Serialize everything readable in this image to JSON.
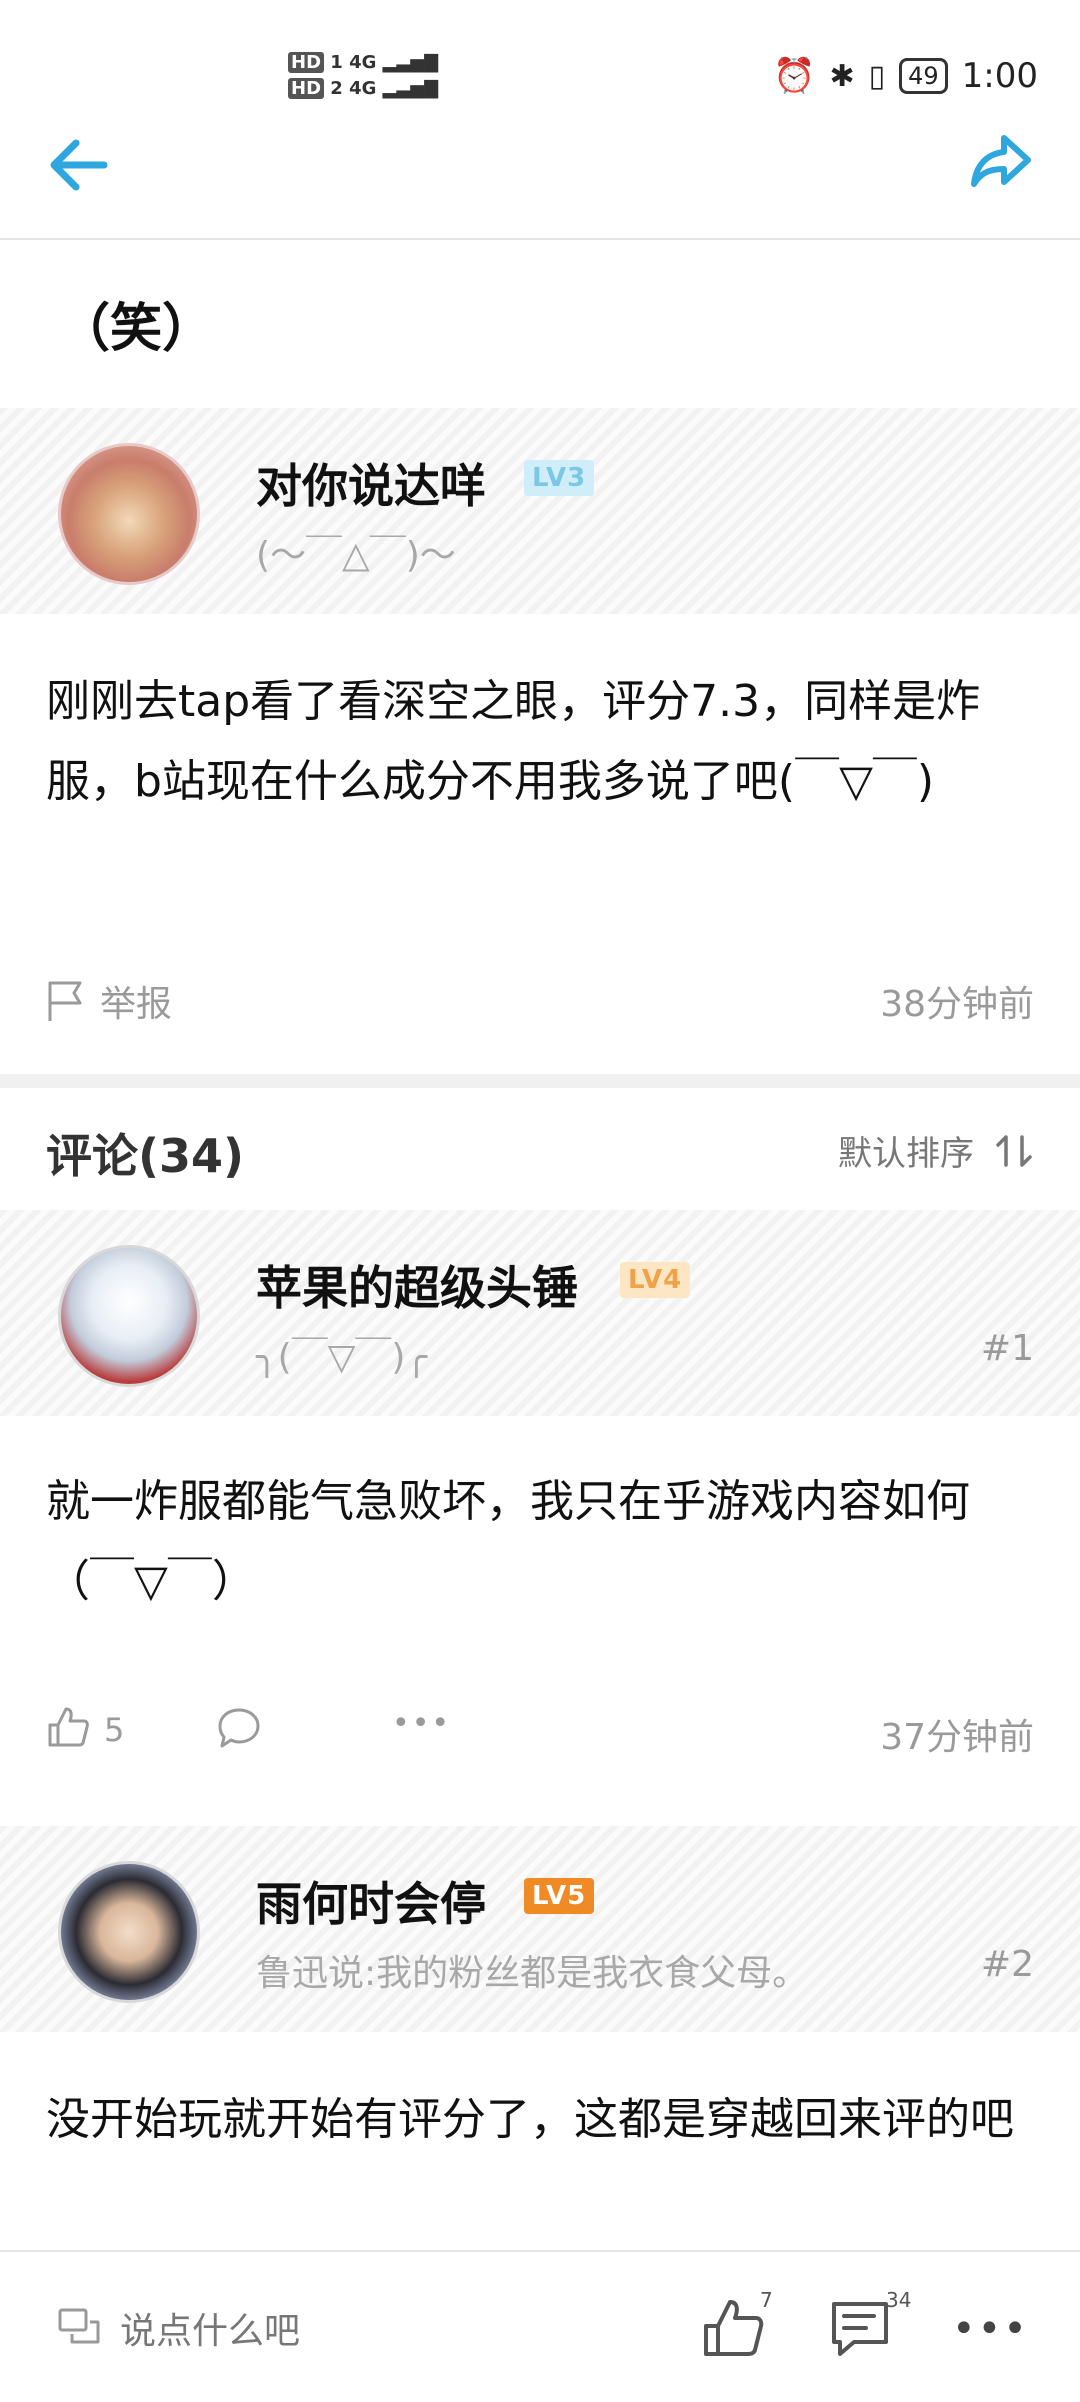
{
  "status_bar": {
    "net_left": "HD 1\nHD 2",
    "signal1": "4G",
    "signal2": "4G",
    "battery": "49",
    "time": "1:00"
  },
  "post": {
    "title": "（笑）",
    "author": {
      "name": "对你说达咩",
      "level": "LV3",
      "level_color": "#8fd0e8",
      "signature": "(～￣△￣)～"
    },
    "content": "刚刚去tap看了看深空之眼，评分7.3，同样是炸服，b站现在什么成分不用我多说了吧(￣▽￣)",
    "report_label": "举报",
    "time": "38分钟前"
  },
  "comments_header": {
    "title": "评论(34)",
    "sort_label": "默认排序"
  },
  "comments": [
    {
      "name": "苹果的超级头锤",
      "level": "LV4",
      "level_color": "#f6b96b",
      "signature": "╮(￣▽￣)╭",
      "floor": "#1",
      "content": "就一炸服都能气急败坏，我只在乎游戏内容如何（￣▽￣）",
      "likes": "5",
      "time": "37分钟前"
    },
    {
      "name": "雨何时会停",
      "level": "LV5",
      "level_color": "#f08a24",
      "signature": "鲁迅说:我的粉丝都是我衣食父母。",
      "floor": "#2",
      "content": "没开始玩就开始有评分了，这都是穿越回来评的吧"
    }
  ],
  "bottom_bar": {
    "placeholder": "说点什么吧",
    "like_count": "7",
    "comment_count": "34"
  },
  "colors": {
    "accent": "#2ea6e0"
  }
}
